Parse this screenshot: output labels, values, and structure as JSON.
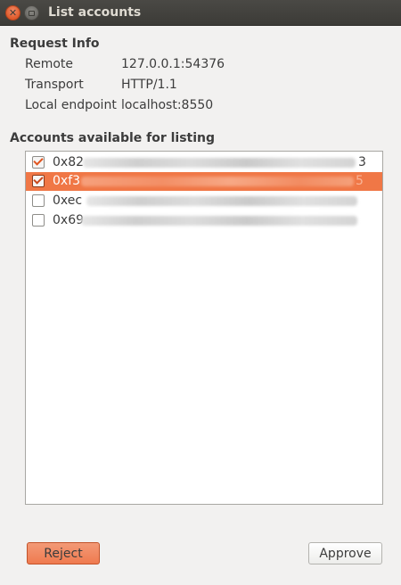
{
  "window": {
    "title": "List accounts"
  },
  "request_info": {
    "heading": "Request Info",
    "rows": [
      {
        "label": "Remote",
        "value": "127.0.0.1:54376"
      },
      {
        "label": "Transport",
        "value": "HTTP/1.1"
      },
      {
        "label": "Local endpoint",
        "value": "localhost:8550"
      }
    ]
  },
  "accounts": {
    "heading": "Accounts available for listing",
    "items": [
      {
        "prefix": "0x82",
        "suffix": "3",
        "checked": true,
        "selected": false
      },
      {
        "prefix": "0xf3",
        "suffix": "5",
        "checked": true,
        "selected": true
      },
      {
        "prefix": "0xec",
        "suffix": "",
        "checked": false,
        "selected": false
      },
      {
        "prefix": "0x69",
        "suffix": "",
        "checked": false,
        "selected": false
      }
    ]
  },
  "buttons": {
    "reject_label": "Reject",
    "approve_label": "Approve"
  },
  "colors": {
    "accent": "#f07746",
    "titlebar": "#3c3b37"
  }
}
